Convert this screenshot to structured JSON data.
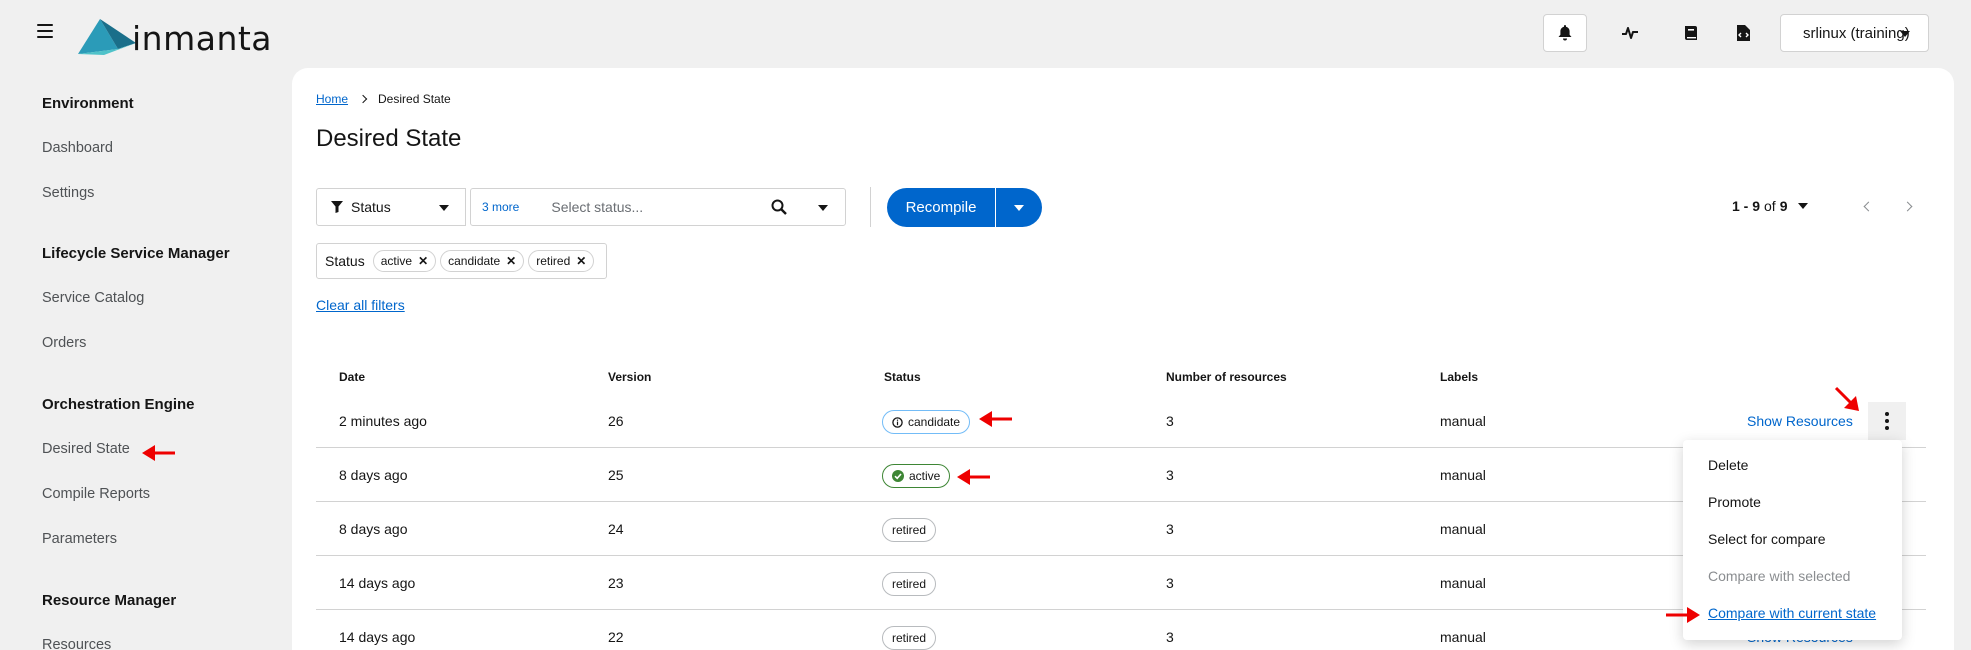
{
  "app": {
    "logo_text": "inmanta"
  },
  "header": {
    "environment": "srlinux (training)"
  },
  "sidebar": {
    "groups": [
      {
        "title": "Environment",
        "items": [
          "Dashboard",
          "Settings"
        ]
      },
      {
        "title": "Lifecycle Service Manager",
        "items": [
          "Service Catalog",
          "Orders"
        ]
      },
      {
        "title": "Orchestration Engine",
        "items": [
          "Desired State",
          "Compile Reports",
          "Parameters"
        ]
      },
      {
        "title": "Resource Manager",
        "items": [
          "Resources"
        ]
      }
    ]
  },
  "breadcrumb": {
    "home": "Home",
    "current": "Desired State"
  },
  "page": {
    "title": "Desired State"
  },
  "toolbar": {
    "filter_type": "Status",
    "more_chips": "3 more",
    "status_placeholder": "Select status...",
    "recompile_label": "Recompile",
    "pagination_range": "1 - 9",
    "pagination_of": "of",
    "pagination_total": "9"
  },
  "filters": {
    "category": "Status",
    "chips": [
      "active",
      "candidate",
      "retired"
    ],
    "clear_label": "Clear all filters"
  },
  "table": {
    "headers": [
      "Date",
      "Version",
      "Status",
      "Number of resources",
      "Labels"
    ],
    "show_resources_label": "Show Resources",
    "rows": [
      {
        "date": "2 minutes ago",
        "version": "26",
        "status": "candidate",
        "resources": "3",
        "labels": "manual"
      },
      {
        "date": "8 days ago",
        "version": "25",
        "status": "active",
        "resources": "3",
        "labels": "manual"
      },
      {
        "date": "8 days ago",
        "version": "24",
        "status": "retired",
        "resources": "3",
        "labels": "manual"
      },
      {
        "date": "14 days ago",
        "version": "23",
        "status": "retired",
        "resources": "3",
        "labels": "manual"
      },
      {
        "date": "14 days ago",
        "version": "22",
        "status": "retired",
        "resources": "3",
        "labels": "manual"
      }
    ]
  },
  "actions_menu": {
    "items": [
      "Delete",
      "Promote",
      "Select for compare",
      "Compare with selected",
      "Compare with current state"
    ]
  },
  "colors": {
    "primary": "#0066cc",
    "annotation_arrow": "#ee0000",
    "active": "#3e8635",
    "candidate": "#73bcf7"
  }
}
